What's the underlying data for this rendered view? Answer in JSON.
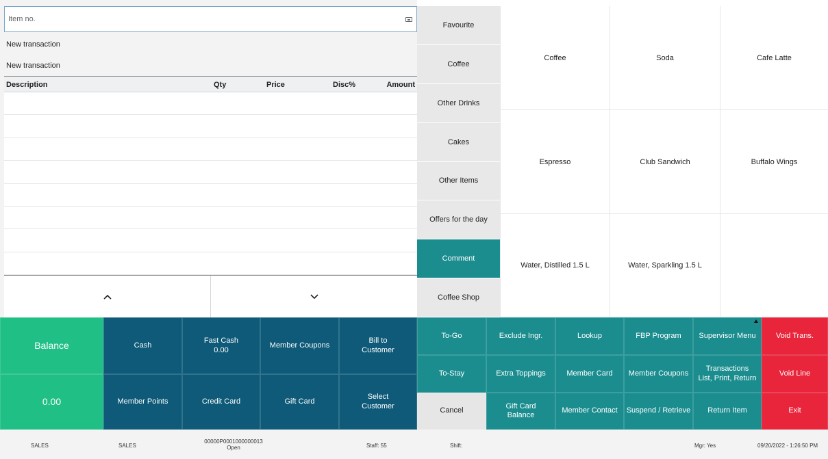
{
  "search": {
    "placeholder": "Item no."
  },
  "transaction": {
    "line1": "New transaction",
    "line2": "New transaction"
  },
  "columns": {
    "description": "Description",
    "qty": "Qty",
    "price": "Price",
    "disc": "Disc%",
    "amount": "Amount"
  },
  "nav": {
    "up": "^",
    "down": "⌄"
  },
  "categories": [
    {
      "label": "Favourite"
    },
    {
      "label": "Coffee"
    },
    {
      "label": "Other Drinks"
    },
    {
      "label": "Cakes"
    },
    {
      "label": "Other Items"
    },
    {
      "label": "Offers for the day"
    },
    {
      "label": "Comment"
    },
    {
      "label": "Coffee Shop"
    }
  ],
  "products": [
    {
      "label": "Coffee"
    },
    {
      "label": "Soda"
    },
    {
      "label": "Cafe Latte"
    },
    {
      "label": "Espresso"
    },
    {
      "label": "Club Sandwich"
    },
    {
      "label": "Buffalo Wings"
    },
    {
      "label": "Water, Distilled 1.5 L"
    },
    {
      "label": "Water, Sparkling 1.5 L"
    },
    {
      "label": ""
    }
  ],
  "payment": {
    "balance_label": "Balance",
    "balance_value": "0.00",
    "cash": "Cash",
    "fast_cash_label": "Fast Cash",
    "fast_cash_value": "0.00",
    "member_coupons": "Member Coupons",
    "bill_to_line1": "Bill to",
    "bill_to_line2": "Customer",
    "member_points": "Member Points",
    "credit_card": "Credit Card",
    "gift_card": "Gift Card",
    "select_line1": "Select",
    "select_line2": "Customer"
  },
  "ops": {
    "to_go": "To-Go",
    "exclude_ingr": "Exclude Ingr.",
    "lookup": "Lookup",
    "fbp_program": "FBP Program",
    "supervisor_menu": "Supervisor Menu",
    "void_trans": "Void Trans.",
    "to_stay": "To-Stay",
    "extra_toppings": "Extra Toppings",
    "member_card": "Member Card",
    "member_coupons": "Member Coupons",
    "transactions_line1": "Transactions",
    "transactions_line2": "List, Print, Return",
    "void_line": "Void Line",
    "cancel": "Cancel",
    "gift_card_balance_line1": "Gift Card",
    "gift_card_balance_line2": "Balance",
    "member_contact": "Member Contact",
    "suspend_retrieve": "Suspend / Retrieve",
    "return_item": "Return Item",
    "exit": "Exit"
  },
  "status": {
    "store": "SALES",
    "terminal": "SALES",
    "receipt_no": "00000P0001000000013",
    "receipt_state": "Open",
    "staff": "Staff: 55",
    "shift": "Shift:",
    "manager": "Mgr: Yes",
    "datetime": "09/20/2022 - 1:26:50 PM"
  },
  "colors": {
    "teal": "#1b8d8f",
    "navy": "#0e5a78",
    "green": "#1fbf86",
    "red": "#e8253b"
  }
}
